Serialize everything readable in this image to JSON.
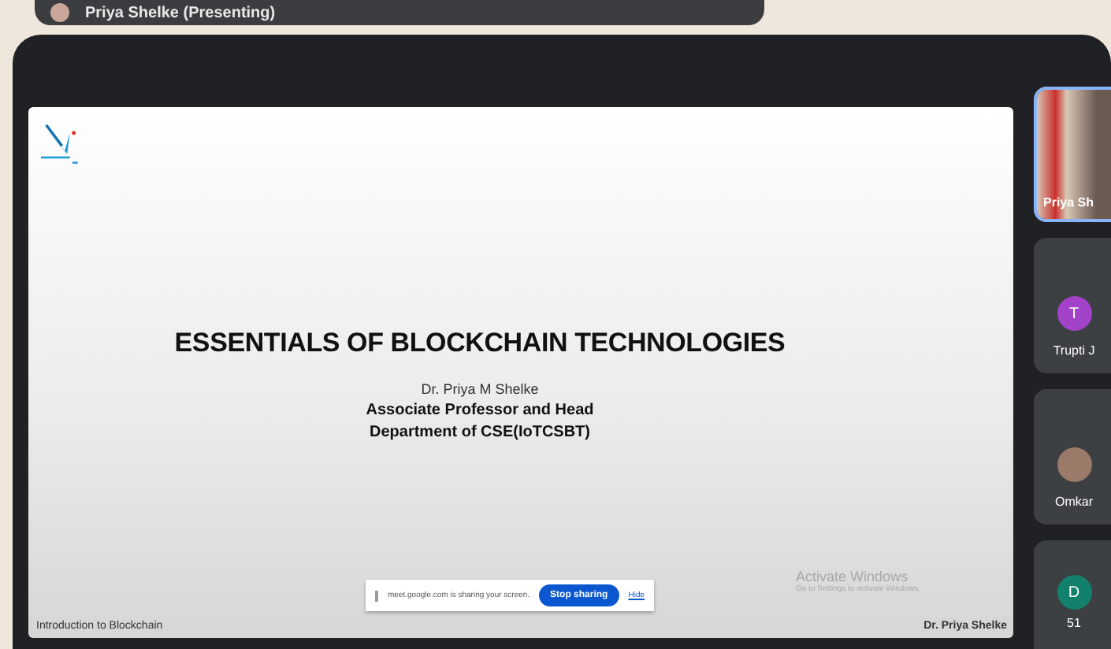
{
  "header": {
    "title": "Priya Shelke (Presenting)"
  },
  "slide": {
    "title": "ESSENTIALS OF BLOCKCHAIN TECHNOLOGIES",
    "author": "Dr. Priya M Shelke",
    "role": "Associate Professor and Head",
    "department": "Department of CSE(IoTCSBT)",
    "footer_left": "Introduction to Blockchain",
    "footer_right": "Dr. Priya Shelke"
  },
  "share_bar": {
    "message": "meet.google.com is sharing your screen.",
    "stop_button": "Stop sharing",
    "hide_link": "Hide"
  },
  "windows_notice": {
    "title": "Activate Windows",
    "subtitle": "Go to Settings to activate Windows."
  },
  "participants": [
    {
      "kind": "video",
      "name": "Priya Sh",
      "highlighted": true
    },
    {
      "kind": "avatar",
      "name": "Trupti J",
      "initial": "T",
      "color": "#a142c9",
      "highlighted": false
    },
    {
      "kind": "photo",
      "name": "Omkar",
      "highlighted": false
    },
    {
      "kind": "avatar",
      "name": "51",
      "initial": "D",
      "color": "#12806b",
      "highlighted": false
    }
  ]
}
